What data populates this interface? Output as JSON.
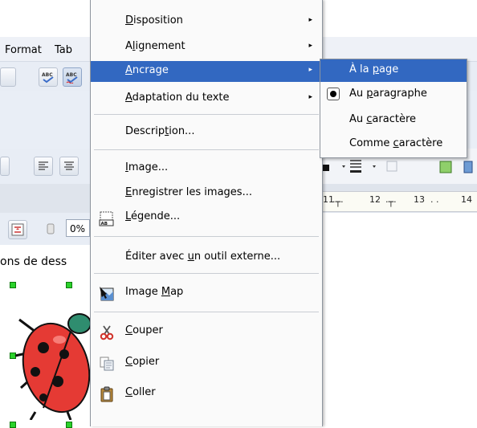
{
  "background_app": {
    "menubar": {
      "format_label": "Format",
      "table_label": "Tab"
    },
    "ruler_ticks": [
      "11",
      "12",
      "13",
      "14"
    ],
    "zoom_value": "0%",
    "document_text": "ons de dess"
  },
  "context_menu": {
    "items": [
      {
        "pre": "",
        "mn": "D",
        "post": "isposition",
        "submenu": true
      },
      {
        "pre": "A",
        "mn": "l",
        "post": "ignement",
        "submenu": true
      },
      {
        "pre": "",
        "mn": "A",
        "post": "ncrage",
        "submenu": true,
        "highlighted": true
      },
      {
        "pre": "",
        "mn": "A",
        "post": "daptation du texte",
        "submenu": true
      },
      {
        "pre": "Descrip",
        "mn": "t",
        "post": "ion..."
      },
      {
        "pre": "",
        "mn": "I",
        "post": "mage..."
      },
      {
        "pre": "",
        "mn": "E",
        "post": "nregistrer les images..."
      },
      {
        "pre": "",
        "mn": "L",
        "post": "égende..."
      },
      {
        "pre": "Éditer avec ",
        "mn": "u",
        "post": "n outil externe..."
      },
      {
        "pre": "Image ",
        "mn": "M",
        "post": "ap"
      },
      {
        "pre": "",
        "mn": "C",
        "post": "ouper"
      },
      {
        "pre": "",
        "mn": "C",
        "post": "opier"
      },
      {
        "pre": "",
        "mn": "C",
        "post": "oller"
      }
    ],
    "submenu_arrow": "▸",
    "highlight_color": "#3268c1"
  },
  "anchor_submenu": {
    "items": [
      {
        "pre": "À la ",
        "mn": "p",
        "post": "age",
        "highlighted": true
      },
      {
        "pre": "Au ",
        "mn": "p",
        "post": "aragraphe",
        "checked": true
      },
      {
        "pre": "Au ",
        "mn": "c",
        "post": "aractère"
      },
      {
        "pre": "Comme ",
        "mn": "c",
        "post": "aractère"
      }
    ]
  }
}
